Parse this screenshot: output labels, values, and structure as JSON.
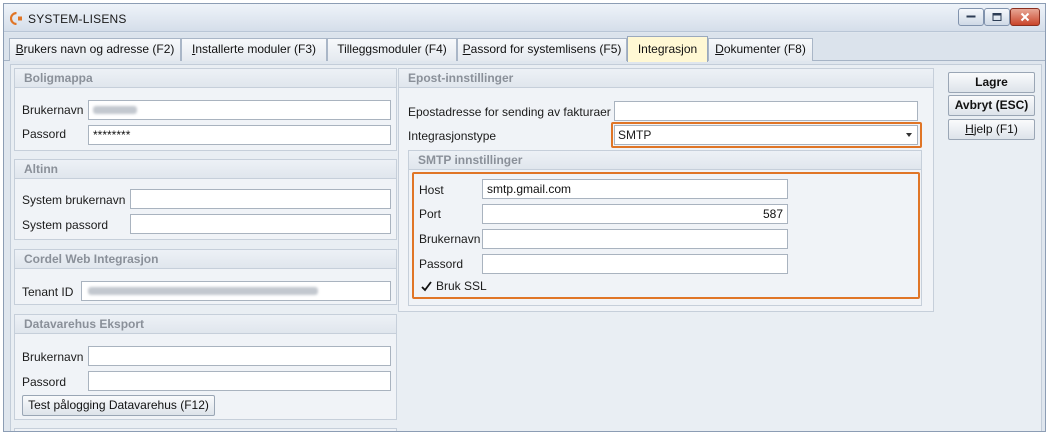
{
  "window": {
    "title": "SYSTEM-LISENS",
    "controls": {
      "minimize": "minimize",
      "maximize": "maximize",
      "close": "close"
    }
  },
  "tabs": [
    {
      "pre": "",
      "ul": "B",
      "post": "rukers navn og adresse (F2)",
      "active": false
    },
    {
      "pre": "",
      "ul": "I",
      "post": "nstallerte moduler (F3)",
      "active": false
    },
    {
      "pre": "Tilleggsmoduler (F4)",
      "ul": "",
      "post": "",
      "active": false
    },
    {
      "pre": "",
      "ul": "P",
      "post": "assord for systemlisens (F5)",
      "active": false
    },
    {
      "pre": "Integrasjon",
      "ul": "",
      "post": "",
      "active": true
    },
    {
      "pre": "",
      "ul": "D",
      "post": "okumenter (F8)",
      "active": false
    }
  ],
  "boligmappa": {
    "header": "Boligmappa",
    "username_label": "Brukernavn",
    "password_label": "Passord",
    "password_value": "********"
  },
  "altinn": {
    "header": "Altinn",
    "username_label": "System brukernavn",
    "password_label": "System passord"
  },
  "cordel": {
    "header": "Cordel Web Integrasjon",
    "tenant_label": "Tenant ID"
  },
  "datavarehus": {
    "header": "Datavarehus Eksport",
    "username_label": "Brukernavn",
    "password_label": "Passord",
    "test_button": "Test pålogging Datavarehus (F12)"
  },
  "epost": {
    "header": "Epost-innstillinger",
    "email_label": "Epostadresse for sending av fakturaer",
    "email_value": "",
    "type_label": "Integrasjonstype",
    "type_value": "SMTP"
  },
  "smtp": {
    "header": "SMTP innstillinger",
    "host_label": "Host",
    "host_value": "smtp.gmail.com",
    "port_label": "Port",
    "port_value": "587",
    "username_label": "Brukernavn",
    "username_value": "",
    "password_label": "Passord",
    "password_value": "",
    "ssl_label": "Bruk SSL",
    "ssl_checked": true
  },
  "actions": {
    "save": "Lagre",
    "cancel": "Avbryt (ESC)",
    "help_ul": "H",
    "help_post": "jelp (F1)"
  },
  "colors": {
    "highlight": "#e07526",
    "active_tab": "#fff8d4",
    "group_header_text": "#8a9099"
  }
}
